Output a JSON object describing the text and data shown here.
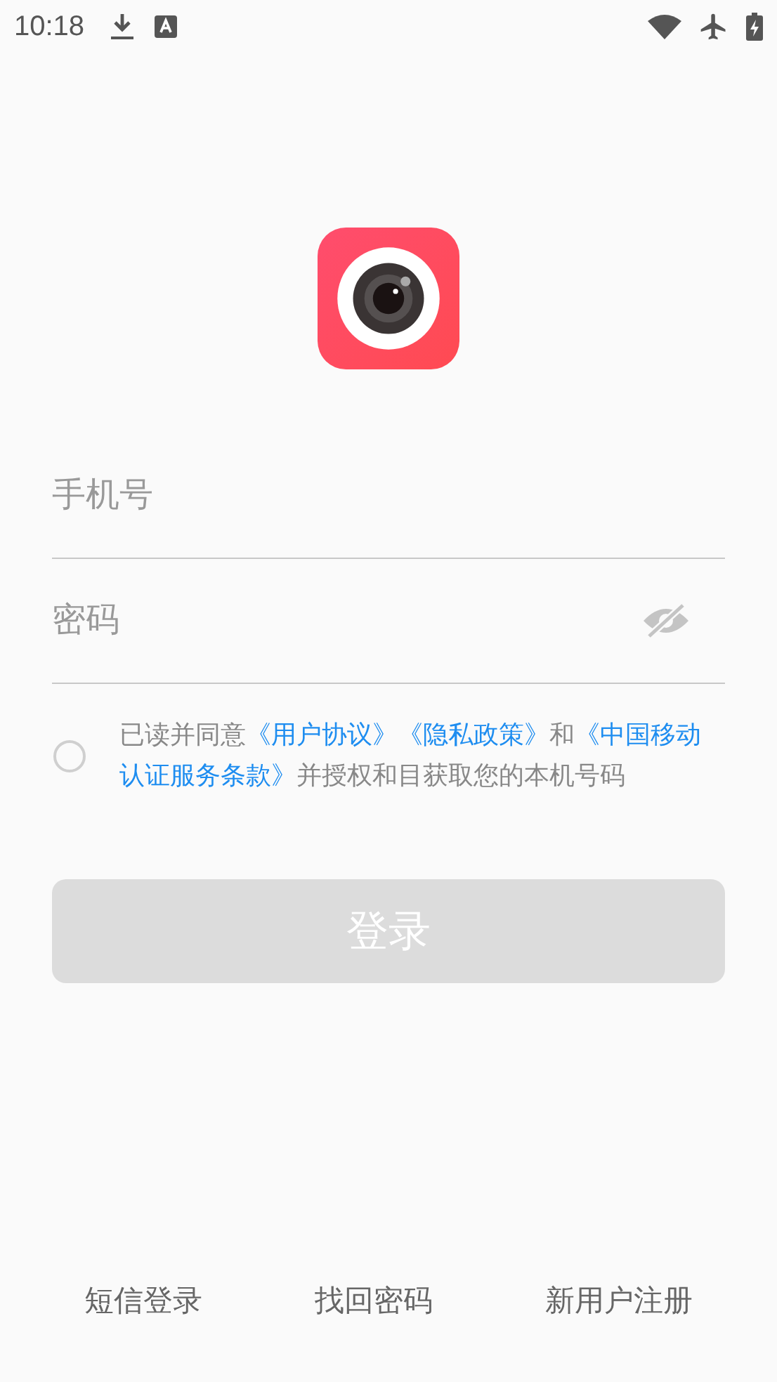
{
  "status_bar": {
    "time": "10:18"
  },
  "form": {
    "phone": {
      "placeholder": "手机号"
    },
    "password": {
      "placeholder": "密码",
      "visible": false
    }
  },
  "agreement": {
    "checked": false,
    "lines": [
      [
        {
          "kind": "text",
          "text": "已读并同意"
        },
        {
          "kind": "link",
          "text": "《用户协议》"
        },
        {
          "kind": "link",
          "text": "《隐私政策》"
        },
        {
          "kind": "text",
          "text": "和"
        },
        {
          "kind": "link",
          "text": "《中国移动"
        }
      ],
      [
        {
          "kind": "link",
          "text": "认证服务条款》"
        },
        {
          "kind": "text",
          "text": "并授权和目获取您的本机号码"
        }
      ]
    ]
  },
  "login_button": {
    "label": "登录",
    "disabled": true
  },
  "footer_links": [
    "短信登录",
    "找回密码",
    "新用户注册"
  ]
}
